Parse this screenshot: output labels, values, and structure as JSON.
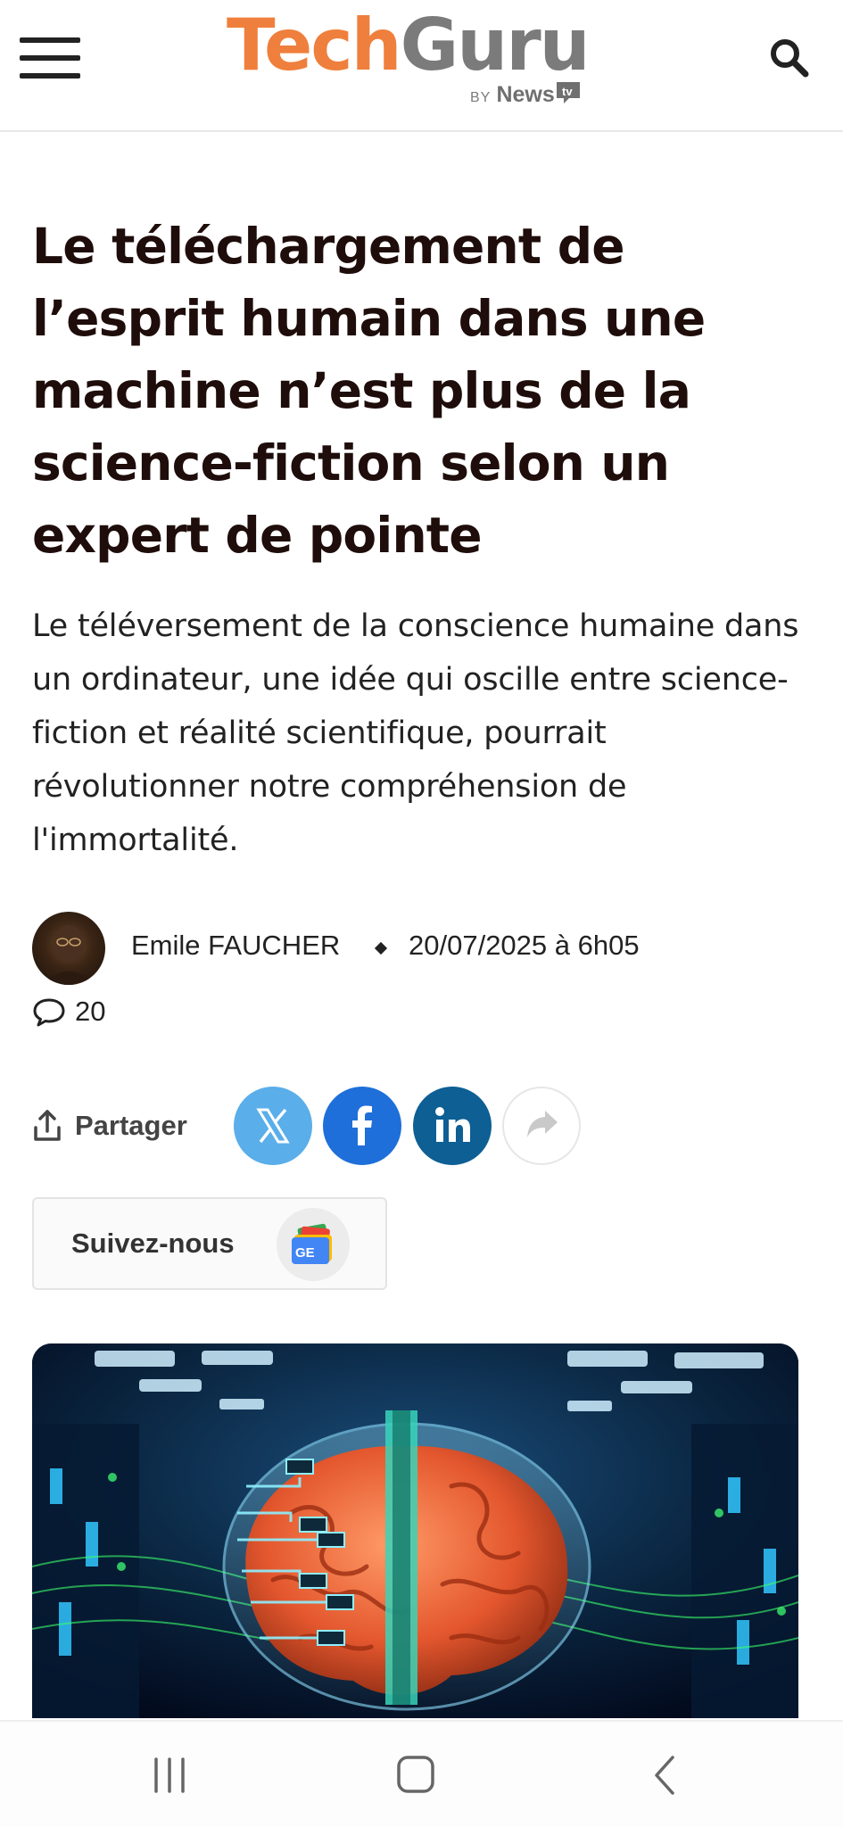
{
  "header": {
    "logo_tech": "Tech",
    "logo_guru": "Guru",
    "logo_by": "BY",
    "logo_news": "News"
  },
  "article": {
    "title": "Le téléchargement de l’esprit humain dans une machine n’est plus de la science-fiction selon un expert de pointe",
    "lede": "Le téléversement de la conscience humaine dans un ordinateur, une idée qui oscille entre science-fiction et réalité scientifique, pourrait révolutionner notre compréhension de l'immortalité.",
    "author": "Emile FAUCHER",
    "date": "20/07/2025 à 6h05",
    "comment_count": "20"
  },
  "share": {
    "label": "Partager",
    "networks": [
      "x-icon",
      "facebook-icon",
      "linkedin-icon",
      "forward-icon"
    ]
  },
  "follow": {
    "label": "Suivez-nous",
    "badge": "GE"
  },
  "colors": {
    "logo_orange": "#ef7f3c",
    "logo_grey": "#7b7b7b",
    "x_blue": "#5aaee9",
    "facebook_blue": "#1e6fd9",
    "linkedin_blue": "#0d5f94",
    "title_text": "#1e0d0a"
  },
  "system_nav": {
    "buttons": [
      "recents-icon",
      "home-icon",
      "back-icon"
    ]
  }
}
